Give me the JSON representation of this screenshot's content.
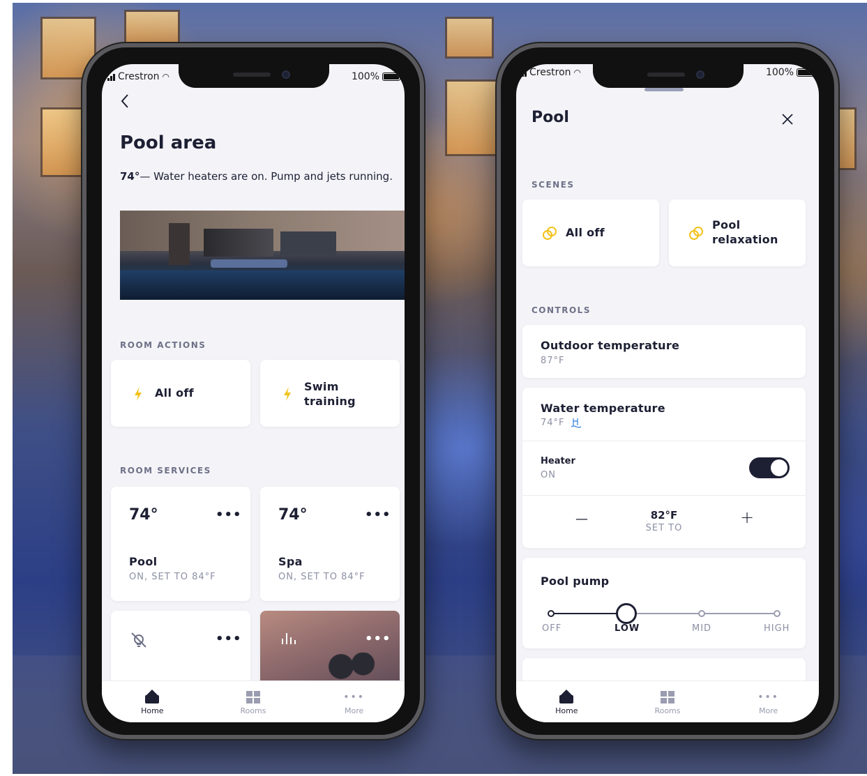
{
  "left_phone": {
    "status": {
      "carrier": "Crestron",
      "battery": "100%"
    },
    "title": "Pool area",
    "summary_temp": "74°",
    "summary_text": "— Water heaters are on. Pump and jets running.",
    "room_actions_label": "ROOM ACTIONS",
    "room_actions": [
      {
        "label": "All off",
        "icon": "bolt-icon"
      },
      {
        "label": "Swim\ntraining",
        "icon": "bolt-icon"
      }
    ],
    "room_services_label": "ROOM SERVICES",
    "services": [
      {
        "temp": "74°",
        "name": "Pool",
        "status": "ON, SET TO 84°F"
      },
      {
        "temp": "74°",
        "name": "Spa",
        "status": "ON, SET TO 84°F"
      }
    ],
    "more_dots": "•••",
    "tabs": [
      {
        "label": "Home",
        "icon": "home-icon"
      },
      {
        "label": "Rooms",
        "icon": "rooms-icon"
      },
      {
        "label": "More",
        "icon": "more-icon"
      }
    ]
  },
  "right_phone": {
    "status": {
      "carrier": "Crestron",
      "battery": "100%"
    },
    "title": "Pool",
    "scenes_label": "SCENES",
    "scenes": [
      {
        "label": "All off",
        "icon": "rings-icon"
      },
      {
        "label": "Pool\nrelaxation",
        "icon": "rings-icon"
      }
    ],
    "controls_label": "CONTROLS",
    "outdoor": {
      "title": "Outdoor temperature",
      "value": "87°F"
    },
    "water": {
      "title": "Water temperature",
      "value": "74°F"
    },
    "heater": {
      "title": "Heater",
      "status": "ON",
      "on": true
    },
    "setpoint": {
      "value": "82°F",
      "label": "SET TO",
      "minus": "—",
      "plus": "+"
    },
    "pump": {
      "title": "Pool pump",
      "levels": [
        "OFF",
        "LOW",
        "MID",
        "HIGH"
      ],
      "selected": "LOW"
    },
    "tabs": [
      {
        "label": "Home",
        "icon": "home-icon"
      },
      {
        "label": "Rooms",
        "icon": "rooms-icon"
      },
      {
        "label": "More",
        "icon": "more-icon"
      }
    ]
  },
  "colors": {
    "accent_yellow": "#f2c21b",
    "ink": "#1d1f33",
    "muted": "#8c8fa3"
  }
}
